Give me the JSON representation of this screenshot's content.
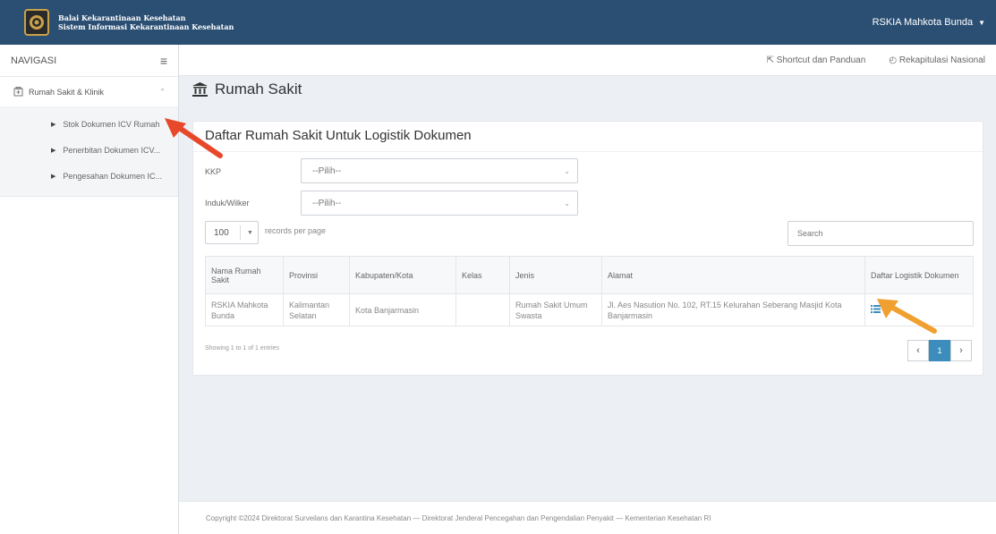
{
  "header": {
    "brand_line1": "Balai Kekarantinaan Kesehatan",
    "brand_line2": "Sistem Informasi Kekarantinaan Kesehatan",
    "user_label": "RSKIA Mahkota Bunda"
  },
  "sidebar": {
    "title": "NAVIGASI",
    "group_label": "Rumah Sakit & Klinik",
    "items": [
      {
        "label": "Stok Dokumen ICV Rumah"
      },
      {
        "label": "Penerbitan Dokumen ICV..."
      },
      {
        "label": "Pengesahan Dokumen IC..."
      }
    ]
  },
  "subbar": {
    "shortcut_label": "Shortcut dan Panduan",
    "rekap_label": "Rekapitulasi Nasional"
  },
  "page": {
    "title": "Rumah Sakit"
  },
  "panel": {
    "title": "Daftar Rumah Sakit Untuk Logistik Dokumen",
    "filters": [
      {
        "label": "KKP",
        "value": "--Pilih--"
      },
      {
        "label": "Induk/Wilker",
        "value": "--Pilih--"
      }
    ],
    "page_length": "100",
    "page_length_label": "records per page",
    "search_placeholder": "Search",
    "table": {
      "headers": [
        "Nama Rumah Sakit",
        "Provinsi",
        "Kabupaten/Kota",
        "Kelas",
        "Jenis",
        "Alamat",
        "Daftar Logistik Dokumen"
      ],
      "rows": [
        {
          "nama": "RSKIA Mahkota Bunda",
          "provinsi": "Kalimantan Selatan",
          "kabupaten": "Kota Banjarmasin",
          "kelas": "",
          "jenis": "Rumah Sakit Umum Swasta",
          "alamat": "Jl. Aes Nasution No. 102, RT.15 Kelurahan Seberang Masjid Kota Banjarmasin",
          "daftar_icon": "list-icon"
        }
      ]
    },
    "info_text": "Showing 1 to 1 of 1 entries",
    "pagination": {
      "prev": "‹",
      "current": "1",
      "next": "›"
    }
  },
  "footer": {
    "text": "Copyright ©2024 Direktorat Surveilans dan Karantina Kesehatan — Direktorat Jenderal Pencegahan dan Pengendalian Penyakit — Kementerian Kesehatan RI"
  },
  "colors": {
    "topbar": "#2b4f73",
    "accent": "#3c8dbc",
    "annotation_red": "#e8482a",
    "annotation_orange": "#f0a030"
  }
}
